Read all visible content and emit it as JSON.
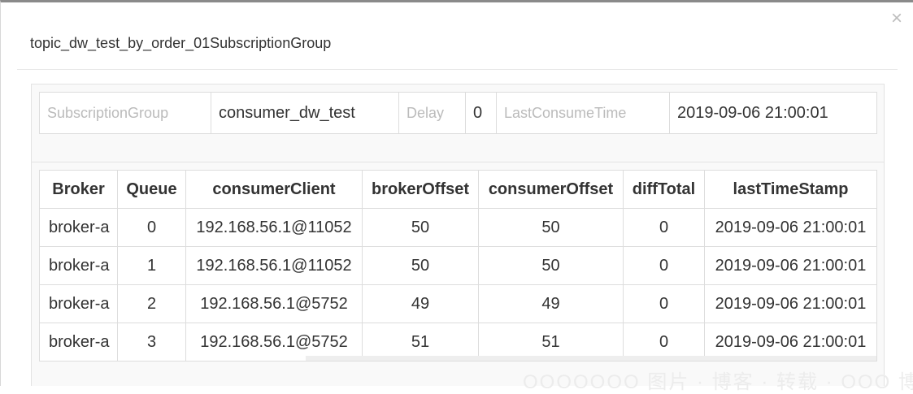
{
  "modal": {
    "title": "topic_dw_test_by_order_01SubscriptionGroup",
    "close_label": "×"
  },
  "info": {
    "subscription_group_label": "SubscriptionGroup",
    "subscription_group_value": "consumer_dw_test",
    "delay_label": "Delay",
    "delay_value": "0",
    "last_consume_time_label": "LastConsumeTime",
    "last_consume_time_value": "2019-09-06 21:00:01"
  },
  "table": {
    "columns": [
      "Broker",
      "Queue",
      "consumerClient",
      "brokerOffset",
      "consumerOffset",
      "diffTotal",
      "lastTimeStamp"
    ],
    "rows": [
      [
        "broker-a",
        "0",
        "192.168.56.1@11052",
        "50",
        "50",
        "0",
        "2019-09-06 21:00:01"
      ],
      [
        "broker-a",
        "1",
        "192.168.56.1@11052",
        "50",
        "50",
        "0",
        "2019-09-06 21:00:01"
      ],
      [
        "broker-a",
        "2",
        "192.168.56.1@5752",
        "49",
        "49",
        "0",
        "2019-09-06 21:00:01"
      ],
      [
        "broker-a",
        "3",
        "192.168.56.1@5752",
        "51",
        "51",
        "0",
        "2019-09-06 21:00:01"
      ]
    ]
  },
  "watermark": "OOOOOOO 图片 · 博客 · 转载 · OOO 博客"
}
